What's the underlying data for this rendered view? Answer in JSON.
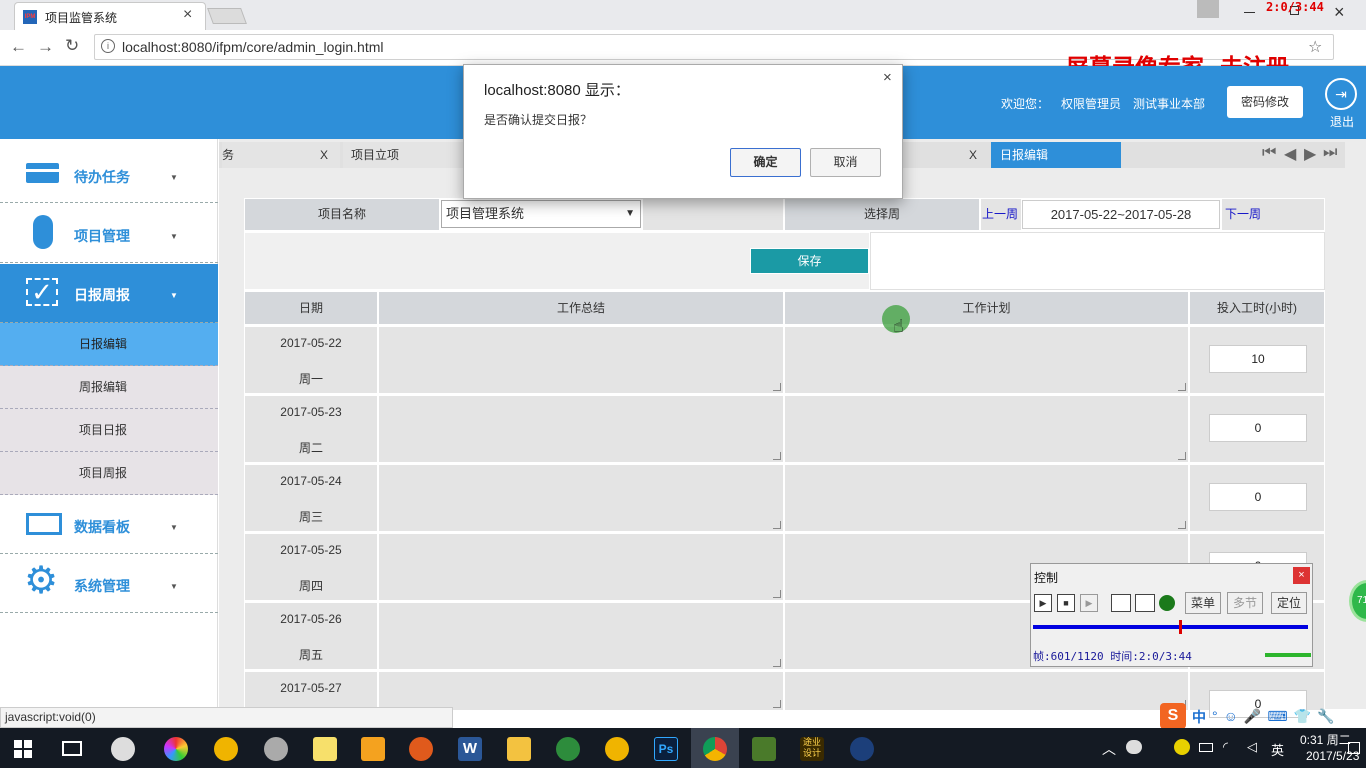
{
  "browser": {
    "tab_title": "项目监管系统",
    "tab_favicon_text": "IPM",
    "url": "localhost:8080/ifpm/core/admin_login.html",
    "status_text": "javascript:void(0)"
  },
  "recorder": {
    "timer": "2:0/3:44",
    "watermark": "屏幕录像专家  未注册",
    "control_title": "控制",
    "menu_label": "菜单",
    "multi_label": "多节",
    "locate_label": "定位",
    "frame_info": "帧:601/1120 时间:2:0/3:44",
    "badge_text": "71"
  },
  "header": {
    "welcome": "欢迎您：",
    "role": "权限管理员",
    "dept": "测试事业本部",
    "change_pwd": "密码修改",
    "logout": "退出"
  },
  "sidebar": {
    "items": [
      {
        "label": "待办任务",
        "icon": "card-icon"
      },
      {
        "label": "项目管理",
        "icon": "mouse-icon"
      },
      {
        "label": "日报周报",
        "icon": "checkbox-icon"
      },
      {
        "label": "数据看板",
        "icon": "board-icon"
      },
      {
        "label": "系统管理",
        "icon": "gear-icon"
      }
    ],
    "sub_items": [
      "日报编辑",
      "周报编辑",
      "项目日报",
      "项目周报"
    ]
  },
  "content_tabs": {
    "tab1": "务",
    "tab1_close": "X",
    "tab2": "项目立项",
    "tab3_close": "X",
    "tab_active": "日报编辑"
  },
  "form": {
    "project_label": "项目名称",
    "project_value": "项目管理系统",
    "week_label": "选择周",
    "prev_week": "上一周",
    "week_value": "2017-05-22~2017-05-28",
    "next_week": "下一周",
    "save": "保存"
  },
  "table": {
    "headers": [
      "日期",
      "工作总结",
      "工作计划",
      "投入工时(小时)"
    ],
    "rows": [
      {
        "date": "2017-05-22",
        "weekday": "周一",
        "hours": "10"
      },
      {
        "date": "2017-05-23",
        "weekday": "周二",
        "hours": "0"
      },
      {
        "date": "2017-05-24",
        "weekday": "周三",
        "hours": "0"
      },
      {
        "date": "2017-05-25",
        "weekday": "周四",
        "hours": "0"
      },
      {
        "date": "2017-05-26",
        "weekday": "周五",
        "hours": ""
      },
      {
        "date": "2017-05-27",
        "weekday": "",
        "hours": "0"
      }
    ]
  },
  "dialog": {
    "title": "localhost:8080 显示：",
    "message": "是否确认提交日报？",
    "ok": "确定",
    "cancel": "取消",
    "close": "×"
  },
  "taskbar": {
    "ime": "中",
    "lang": "英",
    "time": "0:31 周二",
    "date": "2017/5/23",
    "app_word": "W",
    "app_ps": "Ps",
    "app_design": "途业设计"
  },
  "colors": {
    "brand": "#2e8fd9",
    "save_button": "#1b9aa5",
    "taskbar": "#141a23"
  }
}
